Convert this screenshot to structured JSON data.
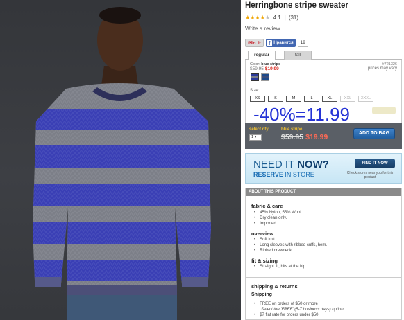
{
  "product": {
    "title": "Herringbone stripe sweater",
    "stars": "★★★★",
    "stars_off": "★",
    "rating": "4.1",
    "reviews": "(31)",
    "write_review": "Write a review"
  },
  "social": {
    "pin": "Pin it",
    "fb_label": "Нравится",
    "fb_count": "19"
  },
  "tabs": [
    "regular",
    "tall"
  ],
  "options": {
    "color_label": "Color:",
    "color_value": "blue stripe",
    "old_price": "$59.95",
    "new_price": "$19.99",
    "sku": "#721326",
    "vary": "prices may vary",
    "size_label": "Size:",
    "sizes": [
      "XS",
      "S",
      "M",
      "L",
      "XL",
      "XXL",
      "XXXL"
    ]
  },
  "promo": "-40%=11.99",
  "cart": {
    "qty_label": "select qty",
    "qty_value": "1",
    "color": "blue stripe",
    "old_price": "$59.95",
    "new_price": "$19.99",
    "add_button": "ADD TO BAG"
  },
  "store": {
    "need": "NEED IT ",
    "now": "NOW?",
    "reserve": "RESERVE",
    "in_store": " IN STORE",
    "find_button": "FIND IT NOW",
    "note": "Check stores near you for this product"
  },
  "about": {
    "header": "ABOUT THIS PRODUCT",
    "fabric_title": "fabric & care",
    "fabric": [
      "45% Nylon, 55% Wool.",
      "Dry clean only.",
      "Imported."
    ],
    "overview_title": "overview",
    "overview": [
      "Soft knit.",
      "Long sleeves with ribbed cuffs, hem.",
      "Ribbed crewneck."
    ],
    "fit_title": "fit & sizing",
    "fit": [
      "Straight fit, hits at the hip."
    ],
    "shipping_title": "shipping & returns",
    "shipping_sub": "Shipping",
    "shipping": [
      "FREE on orders of $50 or more",
      "Select the 'FREE' (5-7 business days) option",
      "$7 flat rate for orders under $50"
    ]
  },
  "colors": {
    "accent_blue": "#2533d6",
    "sale_red": "#d8261c",
    "sweater_blue": "#3a3fb5",
    "sweater_gray": "#7c7f88"
  }
}
